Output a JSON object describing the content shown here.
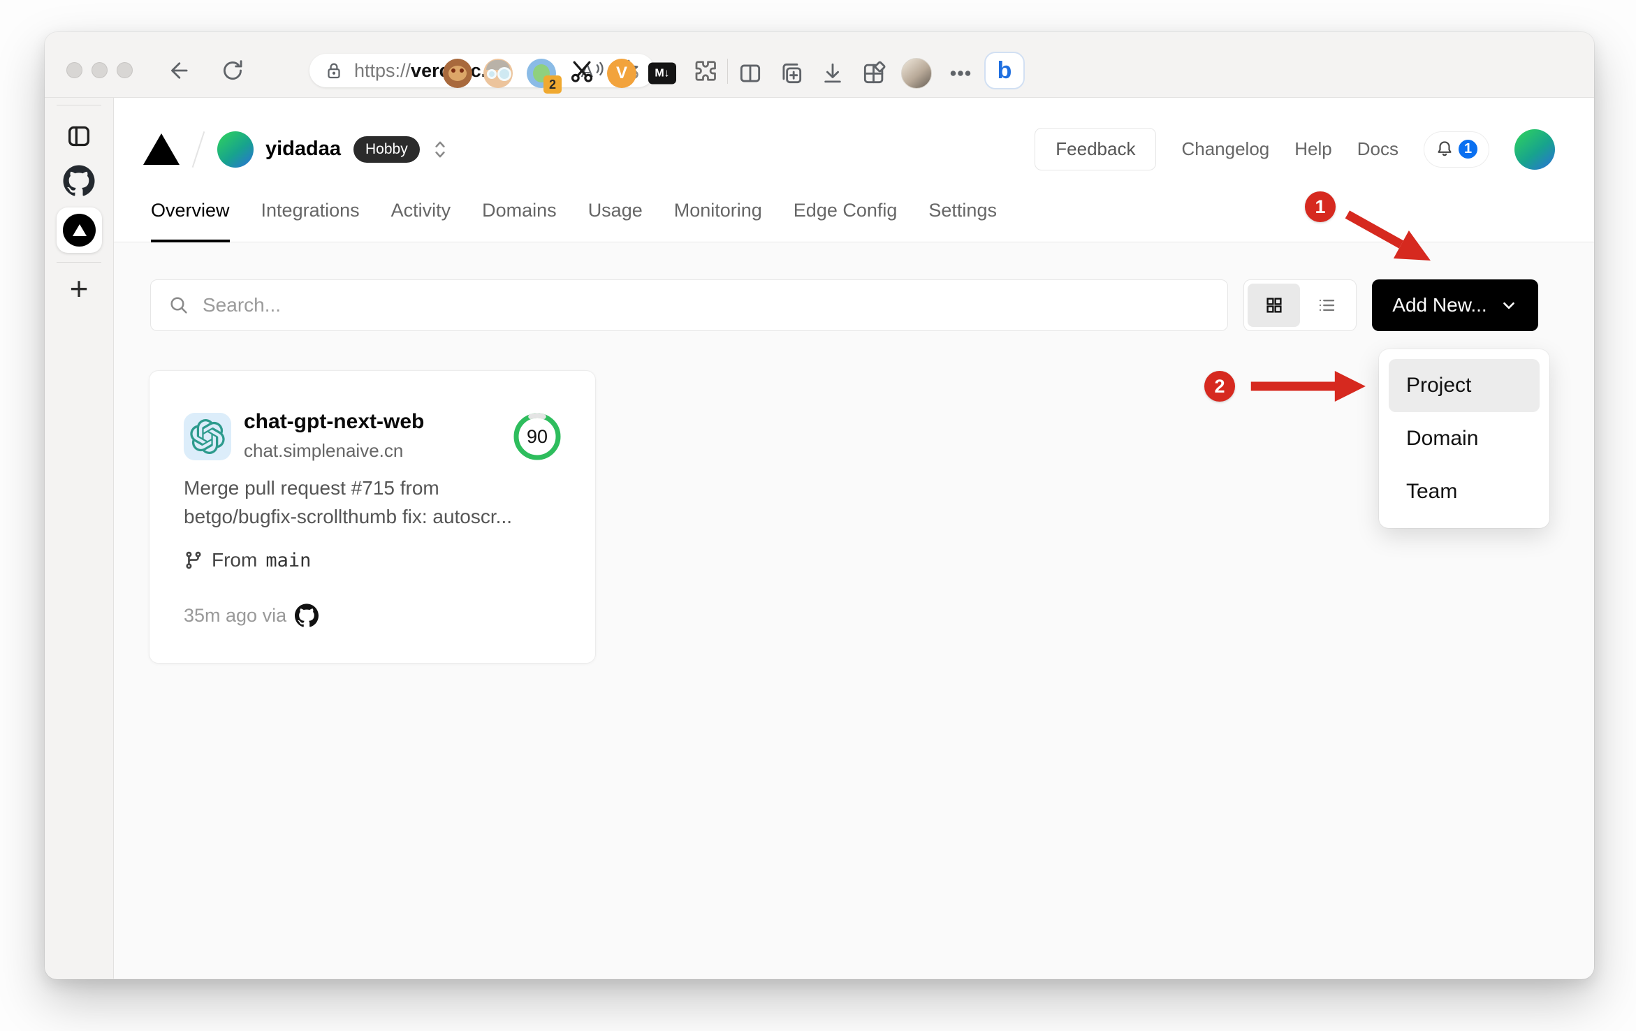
{
  "browser": {
    "url_scheme": "https://",
    "url_host": "vercel.c...",
    "extension_badge_count": "2",
    "md_extension_label": "M↓",
    "v_extension_label": "V",
    "bing_label": "b"
  },
  "header": {
    "team_name": "yidadaa",
    "plan_badge": "Hobby",
    "feedback_label": "Feedback",
    "links": [
      {
        "label": "Changelog"
      },
      {
        "label": "Help"
      },
      {
        "label": "Docs"
      }
    ],
    "notification_count": "1"
  },
  "nav_tabs": [
    {
      "label": "Overview",
      "active": true
    },
    {
      "label": "Integrations",
      "active": false
    },
    {
      "label": "Activity",
      "active": false
    },
    {
      "label": "Domains",
      "active": false
    },
    {
      "label": "Usage",
      "active": false
    },
    {
      "label": "Monitoring",
      "active": false
    },
    {
      "label": "Edge Config",
      "active": false
    },
    {
      "label": "Settings",
      "active": false
    }
  ],
  "controls": {
    "search_placeholder": "Search...",
    "add_new_label": "Add New..."
  },
  "project_card": {
    "name": "chat-gpt-next-web",
    "domain": "chat.simplenaive.cn",
    "score": "90",
    "commit_message_line1": "Merge pull request #715 from",
    "commit_message_line2": "betgo/bugfix-scrollthumb fix: autoscr...",
    "branch_prefix": "From",
    "branch_name": "main",
    "deploy_meta": "35m ago via"
  },
  "dropdown": {
    "items": [
      {
        "label": "Project",
        "highlighted": true
      },
      {
        "label": "Domain",
        "highlighted": false
      },
      {
        "label": "Team",
        "highlighted": false
      }
    ]
  },
  "annotations": {
    "step_1": "1",
    "step_2": "2"
  },
  "colors": {
    "annotation_red": "#d6291f",
    "score_green": "#2ebd5d",
    "notification_blue": "#0b70f0",
    "add_new_black": "#000000"
  }
}
